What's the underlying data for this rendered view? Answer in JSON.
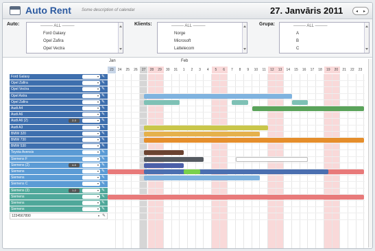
{
  "header": {
    "title": "Auto Rent",
    "description": "Some description of calendar",
    "date": "27. Janvāris 2011",
    "nav_prev": "◂",
    "nav_next": "▸"
  },
  "filters": {
    "auto": {
      "label": "Auto:",
      "all": "ALL",
      "options": [
        "Ford Galaxy",
        "Opel Zafira",
        "Opel Vectra"
      ]
    },
    "klients": {
      "label": "Klients:",
      "all": "ALL",
      "options": [
        "Norge",
        "Microsoft",
        "Lattelecom"
      ]
    },
    "grupa": {
      "label": "Grupa:",
      "all": "ALL",
      "options": [
        "A",
        "B",
        "C"
      ]
    }
  },
  "months": [
    "Jan",
    "Feb"
  ],
  "days": [
    "23",
    "24",
    "25",
    "26",
    "27",
    "28",
    "29",
    "30",
    "31",
    "1",
    "2",
    "3",
    "4",
    "5",
    "6",
    "7",
    "8",
    "9",
    "10",
    "11",
    "12",
    "13",
    "14",
    "15",
    "16",
    "17",
    "18",
    "19",
    "20",
    "21",
    "22",
    "23"
  ],
  "colors": {
    "weekend": "#f9d9d9",
    "today": "#d6d6d6",
    "header_accent": "#c8d6e8"
  },
  "rows": [
    {
      "name": "Ford Galaxy",
      "color": "#3e6fae"
    },
    {
      "name": "Opel Zafira",
      "color": "#3e6fae"
    },
    {
      "name": "Opel Vectra",
      "color": "#3e6fae"
    },
    {
      "name": "Opel Astra",
      "color": "#3e6fae"
    },
    {
      "name": "Opel Zafira",
      "color": "#3e6fae"
    },
    {
      "name": "Audi A4",
      "color": "#3e6fae"
    },
    {
      "name": "Audi A6",
      "color": "#3e6fae"
    },
    {
      "name": "Audi A6 (2)",
      "count": "2-3",
      "color": "#3e6fae"
    },
    {
      "name": "Audi A3",
      "color": "#3e6fae"
    },
    {
      "name": "BMW 320",
      "color": "#3e6fae"
    },
    {
      "name": "BMW 730",
      "color": "#3e6fae"
    },
    {
      "name": "BMW 530",
      "color": "#3e6fae"
    },
    {
      "name": "Toyota Avensis",
      "color": "#5b9bd5"
    },
    {
      "name": "Siemens F",
      "color": "#5b9bd5"
    },
    {
      "name": "Siemens (2)",
      "count": "4-5",
      "color": "#5b9bd5"
    },
    {
      "name": "Siemens",
      "color": "#5b9bd5"
    },
    {
      "name": "Siemens",
      "color": "#5b9bd5"
    },
    {
      "name": "Siemens C",
      "color": "#5b9bd5"
    },
    {
      "name": "Siemens (3)",
      "count": "1-2",
      "color": "#4fa89a"
    },
    {
      "name": "Siemens",
      "color": "#4fa89a"
    },
    {
      "name": "Siemens",
      "color": "#4fa89a"
    },
    {
      "name": "Siemens",
      "color": "#4fa89a"
    },
    {
      "name": "1234567890",
      "color": "#ffffff",
      "dark": true
    }
  ],
  "bars": [
    {
      "row": 3,
      "start": 4.5,
      "end": 23,
      "color": "#7fb3df"
    },
    {
      "row": 4,
      "start": 4.5,
      "end": 9,
      "color": "#7ec1b5"
    },
    {
      "row": 4,
      "start": 15.5,
      "end": 17.5,
      "color": "#7ec1b5"
    },
    {
      "row": 4,
      "start": 23,
      "end": 25,
      "color": "#7ec1b5"
    },
    {
      "row": 5,
      "start": 18,
      "end": 32,
      "color": "#5aa35a"
    },
    {
      "row": 8,
      "start": 4.5,
      "end": 20,
      "color": "#c9c64a"
    },
    {
      "row": 9,
      "start": 4.5,
      "end": 19,
      "color": "#e5b14b"
    },
    {
      "row": 10,
      "start": 4.5,
      "end": 32,
      "color": "#e58e2b"
    },
    {
      "row": 12,
      "start": 4.5,
      "end": 9.5,
      "color": "#6b4331"
    },
    {
      "row": 13,
      "start": 4.5,
      "end": 12,
      "color": "#555a60"
    },
    {
      "row": 13,
      "start": 16,
      "end": 25,
      "color": "#ffffff",
      "border": "#bbbbbb"
    },
    {
      "row": 14,
      "start": 4.5,
      "end": 9.5,
      "color": "#4b5fa8"
    },
    {
      "row": 15,
      "start": 0,
      "end": 32,
      "color": "#e87a7a"
    },
    {
      "row": 15,
      "start": 4.5,
      "end": 27.5,
      "color": "#4b6fb0"
    },
    {
      "row": 15,
      "start": 9.5,
      "end": 11.5,
      "color": "#7ad04b"
    },
    {
      "row": 16,
      "start": 4.5,
      "end": 19,
      "color": "#7fb3df"
    },
    {
      "row": 19,
      "start": 0,
      "end": 32,
      "color": "#e87a7a"
    }
  ]
}
